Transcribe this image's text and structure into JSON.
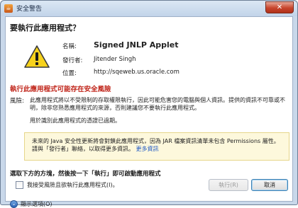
{
  "window": {
    "title": "安全警告",
    "close_label": "✕"
  },
  "dialog": {
    "heading": "要執行此應用程式？",
    "name_label": "名稱:",
    "name_value": "Signed JNLP Applet",
    "publisher_label": "發行者:",
    "publisher_value": "Jitender Singh",
    "location_label": "位置:",
    "location_value": "http://sqeweb.us.oracle.com",
    "risk_heading": "執行此應用程式可能存在安全風險",
    "risk_label": "風險:",
    "risk_text": "此應用程式將以不受限制的存取權限執行，因此可能危害您的電腦與個人資訊。提供的資訊不可靠或不明，除非您熟悉應用程式的來源，否則建議您不要執行此應用程式。",
    "expired_text": "用於識別此應用程式的憑證已過期。",
    "notice_text": "未來的 Java 安全性更新將會對鎖此應用程式，因為 JAR 檔案資訊清單未包含 Permissions 屬性。請與「發行者」聯絡，以取得更多資訊。",
    "notice_link": "更多資訊",
    "accept_heading": "選取下方的方塊，然後按一下「執行」即可啟動應用程式",
    "checkbox_label": "我接受風險且欲執行此應用程式(I)。",
    "run_button": "執行(R)",
    "cancel_button": "取消",
    "details_label": "顯示選項(O)"
  },
  "icons": {
    "title_icon": "java-icon",
    "warning_icon": "warning-triangle-icon",
    "details_icon": "chevron-down-icon"
  },
  "colors": {
    "risk_text": "#c0251a",
    "notice_background": "#fdf8dc",
    "link": "#1a55c4"
  }
}
